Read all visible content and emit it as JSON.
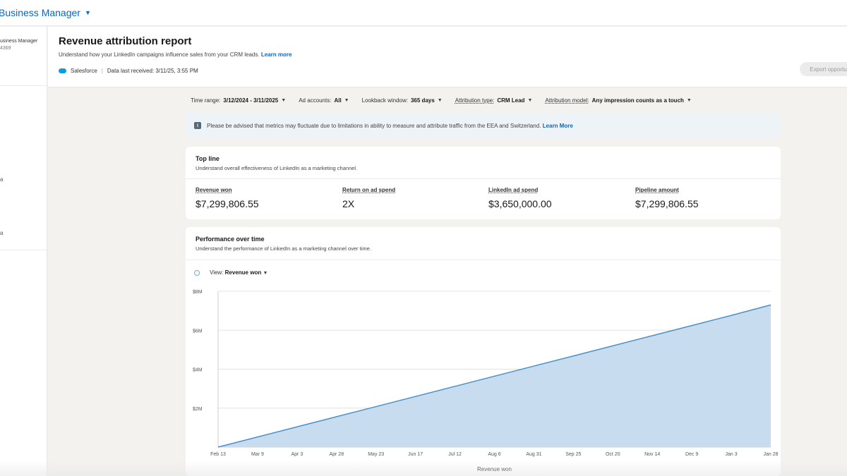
{
  "topbar": {
    "brand": "Business Manager"
  },
  "sidebar": {
    "account_name": "usiness Manager",
    "account_id": "4369",
    "mark_1": "a",
    "mark_2": "a"
  },
  "header": {
    "title": "Revenue attribution report",
    "subtitle": "Understand how your LinkedIn campaigns influence sales from your CRM leads.",
    "subtitle_link": "Learn more",
    "source_name": "Salesforce",
    "data_received": "Data last received: 3/11/25, 3:55 PM",
    "export_label": "Export opportuni"
  },
  "filters": {
    "time_range_label": "Time range:",
    "time_range_value": "3/12/2024 - 3/11/2025",
    "ad_accounts_label": "Ad accounts:",
    "ad_accounts_value": "All",
    "lookback_label": "Lookback window:",
    "lookback_value": "365 days",
    "attribution_type_label": "Attribution type:",
    "attribution_type_value": "CRM Lead",
    "attribution_model_label": "Attribution model:",
    "attribution_model_value": "Any impression counts as a touch"
  },
  "notice": {
    "text": "Please be advised that metrics may fluctuate due to limitations in ability to measure and attribute traffic from the EEA and Switzerland.",
    "link": "Learn More"
  },
  "topline": {
    "title": "Top line",
    "subtitle": "Understand overall effectiveness of LinkedIn as a marketing channel.",
    "metrics": [
      {
        "label": "Revenue won",
        "value": "$7,299,806.55"
      },
      {
        "label": "Return on ad spend",
        "value": "2X"
      },
      {
        "label": "LinkedIn ad spend",
        "value": "$3,650,000.00"
      },
      {
        "label": "Pipeline amount",
        "value": "$7,299,806.55"
      }
    ]
  },
  "performance": {
    "title": "Performance over time",
    "subtitle": "Understand the performance of LinkedIn as a marketing channel over time.",
    "view_label": "View:",
    "view_value": "Revenue won"
  },
  "colors": {
    "accent": "#0a66c2",
    "series_line": "#4a90c8",
    "series_fill": "#c7dcee"
  },
  "chart_data": {
    "type": "area",
    "xlabel": "Revenue won",
    "ylabel": "",
    "y_ticks": [
      "$2M",
      "$4M",
      "$6M",
      "$8M"
    ],
    "y_tick_values": [
      2000000,
      4000000,
      6000000,
      8000000
    ],
    "ylim": [
      0,
      8000000
    ],
    "x": [
      "Feb 13",
      "Mar 9",
      "Apr 3",
      "Apr 28",
      "May 23",
      "Jun 17",
      "Jul 12",
      "Aug 6",
      "Aug 31",
      "Sep 25",
      "Oct 20",
      "Nov 14",
      "Dec 9",
      "Jan 3",
      "Jan 28"
    ],
    "series": [
      {
        "values": [
          0,
          520000,
          1040000,
          1560000,
          2080000,
          2600000,
          3120000,
          3640000,
          4160000,
          4680000,
          5200000,
          5720000,
          6240000,
          6760000,
          7299806
        ]
      }
    ],
    "grid": true
  }
}
